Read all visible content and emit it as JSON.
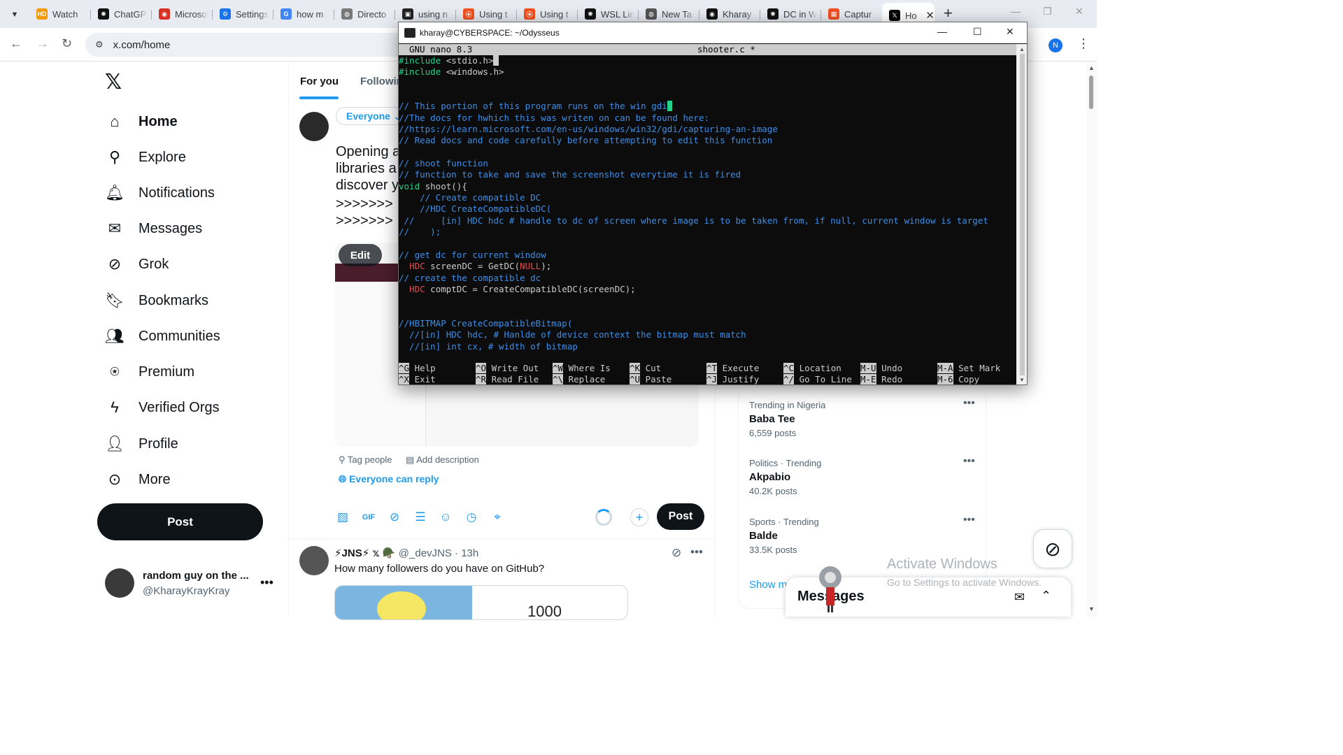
{
  "browser": {
    "tabs": [
      {
        "label": "Watch",
        "fav": "HD",
        "color": "#f29900"
      },
      {
        "label": "ChatGPT",
        "fav": "✺",
        "color": "#111111"
      },
      {
        "label": "Microsoft",
        "fav": "◉",
        "color": "#d93025"
      },
      {
        "label": "Settings",
        "fav": "⚙",
        "color": "#1a73e8"
      },
      {
        "label": "how m",
        "fav": "G",
        "color": "#4285f4"
      },
      {
        "label": "Directo",
        "fav": "◍",
        "color": "#777777"
      },
      {
        "label": "using n",
        "fav": "▣",
        "color": "#222222"
      },
      {
        "label": "Using t",
        "fav": "⦿",
        "color": "#f4511e"
      },
      {
        "label": "Using t",
        "fav": "⦿",
        "color": "#f4511e"
      },
      {
        "label": "WSL Lin",
        "fav": "✺",
        "color": "#111111"
      },
      {
        "label": "New Ta",
        "fav": "◍",
        "color": "#555555"
      },
      {
        "label": "Kharay",
        "fav": "◉",
        "color": "#111111"
      },
      {
        "label": "DC in W",
        "fav": "✺",
        "color": "#111111"
      },
      {
        "label": "Captur",
        "fav": "▦",
        "color": "#f25022"
      }
    ],
    "active_tab": {
      "label": "Ho",
      "fav": "𝕏"
    },
    "url": "x.com/home",
    "profile_initial": "N"
  },
  "x": {
    "nav": [
      {
        "label": "Home",
        "icon": "home-icon",
        "glyph": "⌂",
        "active": true
      },
      {
        "label": "Explore",
        "icon": "search-icon",
        "glyph": "⚲"
      },
      {
        "label": "Notifications",
        "icon": "bell-icon",
        "glyph": "🔔︎"
      },
      {
        "label": "Messages",
        "icon": "mail-icon",
        "glyph": "✉"
      },
      {
        "label": "Grok",
        "icon": "grok-icon",
        "glyph": "⊘"
      },
      {
        "label": "Bookmarks",
        "icon": "bookmark-icon",
        "glyph": "🔖︎"
      },
      {
        "label": "Communities",
        "icon": "people-icon",
        "glyph": "👥︎"
      },
      {
        "label": "Premium",
        "icon": "premium-icon",
        "glyph": "⍟"
      },
      {
        "label": "Verified Orgs",
        "icon": "lightning-icon",
        "glyph": "ϟ"
      },
      {
        "label": "Profile",
        "icon": "profile-icon",
        "glyph": "👤︎"
      },
      {
        "label": "More",
        "icon": "more-circle-icon",
        "glyph": "⊙"
      }
    ],
    "post_label": "Post",
    "account": {
      "name": "random guy on the ...",
      "handle": "@KharayKrayKray"
    },
    "feed_tabs": {
      "for_you": "For you",
      "following": "Followin"
    },
    "composer": {
      "audience": "Everyone",
      "lines": [
        "Opening a",
        "libraries a",
        "discover y",
        ">>>>>>>",
        ">>>>>>>"
      ],
      "edit": "Edit",
      "tag_people": "Tag people",
      "add_description": "Add description",
      "reply_setting": "Everyone can reply",
      "post": "Post"
    },
    "tweet": {
      "user": "⚡JNS⚡ 𝕩 🪖",
      "handle": "@_devJNS · 13h",
      "text": "How many followers do you have on GitHub?",
      "media_number": "1000"
    },
    "trends": [
      {
        "category": "Trending in Nigeria",
        "title": "Baba Tee",
        "count": "6,559 posts"
      },
      {
        "category": "Politics · Trending",
        "title": "Akpabio",
        "count": "40.2K posts"
      },
      {
        "category": "Sports · Trending",
        "title": "Balde",
        "count": "33.5K posts"
      }
    ],
    "show_more": "Show m",
    "messages_drawer": "Messages"
  },
  "activation": {
    "line1": "Activate Windows",
    "line2": "Go to Settings to activate Windows."
  },
  "terminal": {
    "title": "kharay@CYBERSPACE: ~/Odysseus",
    "nano_version": "GNU nano 8.3",
    "filename": "shooter.c *",
    "lines": [
      "#include <stdio.h>",
      "#include <windows.h>",
      "",
      "",
      "// This portion of this program runs on the win gdi",
      "//The docs for hwhich this was writen on can be found here:",
      "//https://learn.microsoft.com/en-us/windows/win32/gdi/capturing-an-image",
      "// Read docs and code carefully before attempting to edit this function",
      "",
      "// shoot function",
      "// function to take and save the screenshot everytime it is fired",
      "void shoot(){",
      "    // Create compatible DC",
      "    //HDC CreateCompatibleDC(",
      " //     [in] HDC hdc # handle to dc of screen where image is to be taken from, if null, current window is target",
      "//    );",
      "",
      "// get dc for current window",
      "  HDC screenDC = GetDC(NULL);",
      "// create the compatible dc",
      "  HDC comptDC = CreateCompatibleDC(screenDC);",
      "",
      "",
      "//HBITMAP CreateCompatibleBitmap(",
      "  //[in] HDC hdc, # Hanlde of device context the bitmap must match",
      "  //[in] int cx, # width of bitmap"
    ],
    "shortcuts": [
      {
        "key": "^G",
        "label": "Help"
      },
      {
        "key": "^X",
        "label": "Exit"
      },
      {
        "key": "^O",
        "label": "Write Out"
      },
      {
        "key": "^R",
        "label": "Read File"
      },
      {
        "key": "^W",
        "label": "Where Is"
      },
      {
        "key": "^\\",
        "label": "Replace"
      },
      {
        "key": "^K",
        "label": "Cut"
      },
      {
        "key": "^U",
        "label": "Paste"
      },
      {
        "key": "^T",
        "label": "Execute"
      },
      {
        "key": "^J",
        "label": "Justify"
      },
      {
        "key": "^C",
        "label": "Location"
      },
      {
        "key": "^/",
        "label": "Go To Line"
      },
      {
        "key": "M-U",
        "label": "Undo"
      },
      {
        "key": "M-E",
        "label": "Redo"
      },
      {
        "key": "M-A",
        "label": "Set Mark"
      },
      {
        "key": "M-6",
        "label": "Copy"
      }
    ]
  }
}
